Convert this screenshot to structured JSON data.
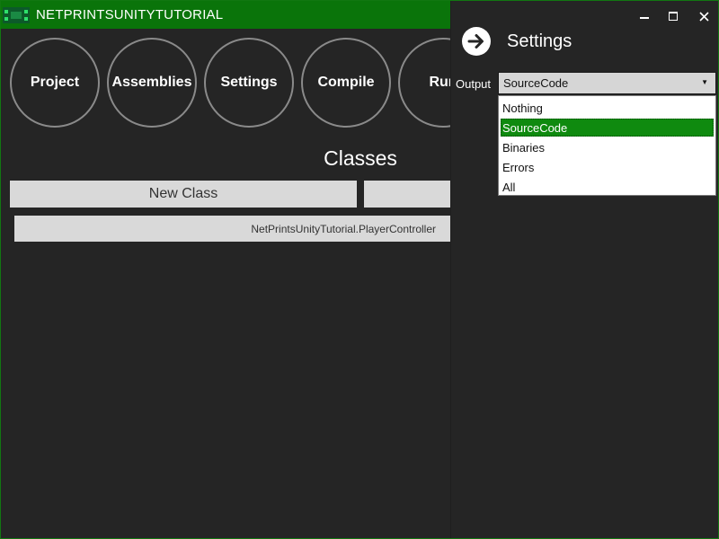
{
  "window": {
    "title": "NETPRINTSUNITYTUTORIAL",
    "accent_color": "#0a740a",
    "icon": "app-grid-icon"
  },
  "nav": [
    {
      "label": "Project"
    },
    {
      "label": "Assemblies"
    },
    {
      "label": "Settings"
    },
    {
      "label": "Compile"
    },
    {
      "label": "Run"
    }
  ],
  "classes": {
    "heading": "Classes",
    "new_class_label": "New Class",
    "second_button_label": "",
    "items": [
      "NetPrintsUnityTutorial.PlayerController"
    ]
  },
  "flyout": {
    "title": "Settings",
    "back_icon": "arrow-right-icon",
    "window_controls": {
      "minimize_icon": "minimize-icon",
      "maximize_icon": "maximize-icon",
      "close_icon": "close-icon"
    },
    "output": {
      "label": "Output",
      "selected": "SourceCode",
      "options": [
        "Nothing",
        "SourceCode",
        "Binaries",
        "Errors",
        "All"
      ],
      "highlight_color": "#0f8a0f"
    }
  }
}
